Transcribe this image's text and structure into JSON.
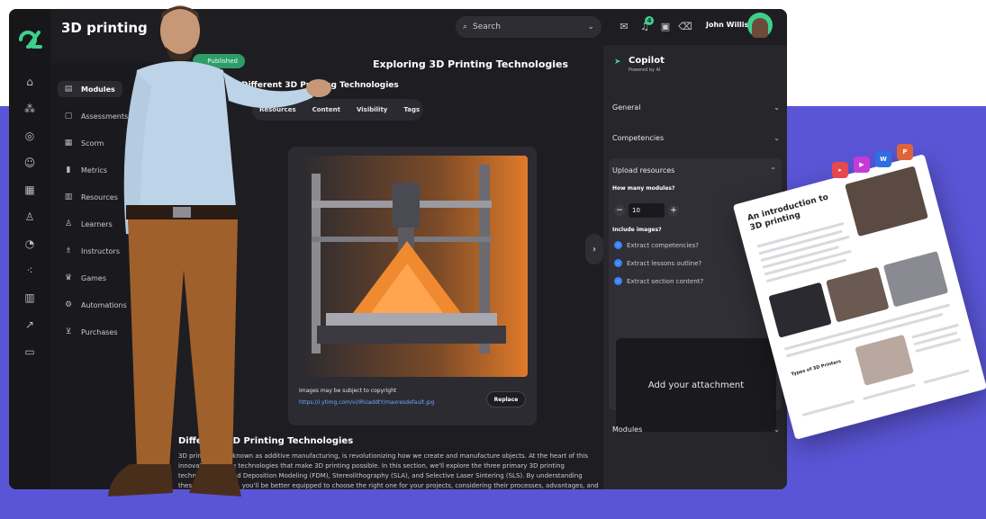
{
  "app": {
    "title": "3D printing",
    "search_placeholder": "Search",
    "notification_count": "4",
    "user_name": "John Willis"
  },
  "nav": {
    "items": [
      {
        "label": "Modules",
        "icon": "modules-icon"
      },
      {
        "label": "Assessments",
        "icon": "assessments-icon"
      },
      {
        "label": "Scorm",
        "icon": "table-icon"
      },
      {
        "label": "Metrics",
        "icon": "metrics-icon"
      },
      {
        "label": "Resources",
        "icon": "library-icon"
      },
      {
        "label": "Learners",
        "icon": "learner-icon"
      },
      {
        "label": "Instructors",
        "icon": "instructor-icon"
      },
      {
        "label": "Games",
        "icon": "trophy-icon"
      },
      {
        "label": "Automations",
        "icon": "automation-icon"
      },
      {
        "label": "Purchases",
        "icon": "cart-icon"
      }
    ]
  },
  "main": {
    "status_label": "Published",
    "course_title": "Exploring 3D Printing Technologies",
    "module_title": "Different 3D Printing Technologies",
    "tabs": [
      "Resources",
      "Content",
      "Visibility",
      "Tags"
    ],
    "image_note": "Images may be subject to copyright",
    "image_link": "https://i.ytimg.com/vi/IRUaddtY/maxresdefault.jpg",
    "replace_label": "Replace",
    "section_heading": "Different 3D Printing Technologies",
    "section_body": "3D printing, also known as additive manufacturing, is revolutionizing how we create and manufacture objects. At the heart of this innovation are the technologies that make 3D printing possible. In this section, we'll explore the three primary 3D printing technologies: Fused Deposition Modeling (FDM), Stereolithography (SLA), and Selective Laser Sintering (SLS). By understanding these technologies, you'll be better equipped to choose the right one for your projects, considering their processes, advantages, and limitations."
  },
  "copilot": {
    "title": "Copilot",
    "subtitle": "Powered by AI",
    "sections": [
      "General",
      "Competencies",
      "Upload resources",
      "Modules"
    ],
    "modules_question": "How many modules?",
    "modules_value": "10",
    "images_question": "Include images?",
    "options": [
      "Extract competencies?",
      "Extract lessons outline?",
      "Extract section content?"
    ],
    "attachment_label": "Add your attachment"
  },
  "document": {
    "title": "An introduction to 3D printing",
    "subheading": "Types of 3D Printers"
  },
  "file_badges": [
    {
      "icon": "pdf-file-icon",
      "color": "#e5484d"
    },
    {
      "icon": "video-file-icon",
      "color": "#c53ad8"
    },
    {
      "icon": "word-file-icon",
      "color": "#2f6fe0",
      "letter": "W"
    },
    {
      "icon": "powerpoint-file-icon",
      "color": "#e0643a",
      "letter": "P"
    }
  ],
  "colors": {
    "accent_green": "#3ecf8e",
    "brand_purple": "#5a55d6",
    "link_blue": "#6fa7ff",
    "app_bg": "#1e1e22"
  }
}
